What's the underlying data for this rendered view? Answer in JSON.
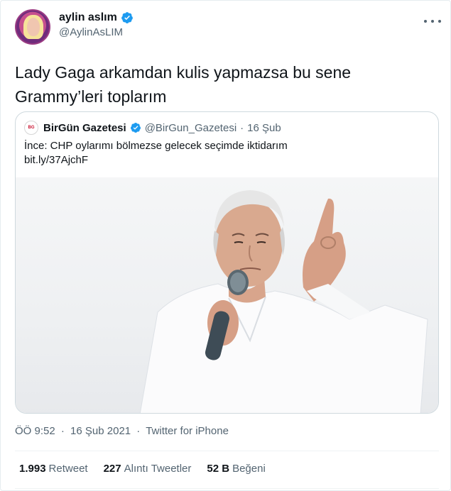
{
  "author": {
    "display_name": "aylin aslım",
    "handle": "@AylinAsLIM"
  },
  "tweet": {
    "text_line1": "Lady Gaga arkamdan kulis yapmazsa bu sene",
    "text_line2": "Grammy’leri toplarım"
  },
  "quoted": {
    "display_name": "BirGün Gazetesi",
    "handle": "@BirGun_Gazetesi",
    "separator": "·",
    "date": "16 Şub",
    "text_line1": "İnce: CHP oylarımı bölmezse gelecek seçimde iktidarım",
    "link": "bit.ly/37AjchF"
  },
  "meta": {
    "time": "ÖÖ 9:52",
    "sep1": "·",
    "date": "16 Şub 2021",
    "sep2": "·",
    "source": "Twitter for iPhone"
  },
  "stats": {
    "retweets_count": "1.993",
    "retweets_label": "Retweet",
    "quotes_count": "227",
    "quotes_label": "Alıntı Tweetler",
    "likes_count": "52 B",
    "likes_label": "Beğeni"
  },
  "colors": {
    "verified": "#1d9bf0",
    "secondary_text": "#536471",
    "border": "#cfd9de"
  },
  "icons": {
    "verified": "verified-badge-icon",
    "more": "more-dots-icon"
  }
}
